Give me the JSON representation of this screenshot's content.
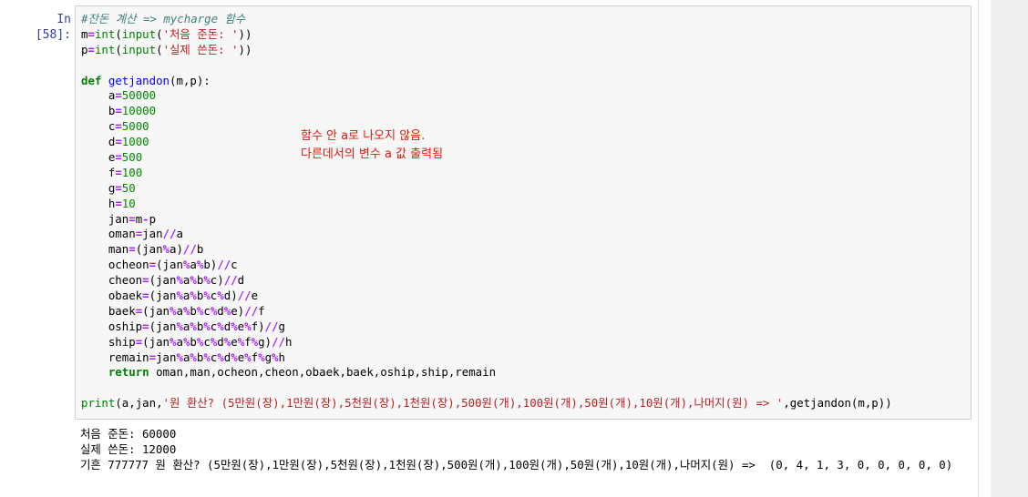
{
  "cell": {
    "prompt": "In [58]:",
    "code_lines": [
      [
        {
          "t": "cm",
          "v": "#잔돈 계산 => mycharge 함수"
        }
      ],
      [
        {
          "t": "",
          "v": "m"
        },
        {
          "t": "op",
          "v": "="
        },
        {
          "t": "bi",
          "v": "int"
        },
        {
          "t": "",
          "v": "("
        },
        {
          "t": "bi",
          "v": "input"
        },
        {
          "t": "",
          "v": "("
        },
        {
          "t": "str",
          "v": "'처음 준돈: '"
        },
        {
          "t": "",
          "v": "))"
        }
      ],
      [
        {
          "t": "",
          "v": "p"
        },
        {
          "t": "op",
          "v": "="
        },
        {
          "t": "bi",
          "v": "int"
        },
        {
          "t": "",
          "v": "("
        },
        {
          "t": "bi",
          "v": "input"
        },
        {
          "t": "",
          "v": "("
        },
        {
          "t": "str",
          "v": "'실제 쓴돈: '"
        },
        {
          "t": "",
          "v": "))"
        }
      ],
      [],
      [
        {
          "t": "kw",
          "v": "def"
        },
        {
          "t": "",
          "v": " "
        },
        {
          "t": "nf",
          "v": "getjandon"
        },
        {
          "t": "",
          "v": "(m,p):"
        }
      ],
      [
        {
          "t": "",
          "v": "    a"
        },
        {
          "t": "op",
          "v": "="
        },
        {
          "t": "num",
          "v": "50000"
        }
      ],
      [
        {
          "t": "",
          "v": "    b"
        },
        {
          "t": "op",
          "v": "="
        },
        {
          "t": "num",
          "v": "10000"
        }
      ],
      [
        {
          "t": "",
          "v": "    c"
        },
        {
          "t": "op",
          "v": "="
        },
        {
          "t": "num",
          "v": "5000"
        }
      ],
      [
        {
          "t": "",
          "v": "    d"
        },
        {
          "t": "op",
          "v": "="
        },
        {
          "t": "num",
          "v": "1000"
        }
      ],
      [
        {
          "t": "",
          "v": "    e"
        },
        {
          "t": "op",
          "v": "="
        },
        {
          "t": "num",
          "v": "500"
        }
      ],
      [
        {
          "t": "",
          "v": "    f"
        },
        {
          "t": "op",
          "v": "="
        },
        {
          "t": "num",
          "v": "100"
        }
      ],
      [
        {
          "t": "",
          "v": "    g"
        },
        {
          "t": "op",
          "v": "="
        },
        {
          "t": "num",
          "v": "50"
        }
      ],
      [
        {
          "t": "",
          "v": "    h"
        },
        {
          "t": "op",
          "v": "="
        },
        {
          "t": "num",
          "v": "10"
        }
      ],
      [
        {
          "t": "",
          "v": "    jan"
        },
        {
          "t": "op",
          "v": "="
        },
        {
          "t": "",
          "v": "m"
        },
        {
          "t": "op",
          "v": "-"
        },
        {
          "t": "",
          "v": "p"
        }
      ],
      [
        {
          "t": "",
          "v": "    oman"
        },
        {
          "t": "op",
          "v": "="
        },
        {
          "t": "",
          "v": "jan"
        },
        {
          "t": "op",
          "v": "//"
        },
        {
          "t": "",
          "v": "a"
        }
      ],
      [
        {
          "t": "",
          "v": "    man"
        },
        {
          "t": "op",
          "v": "="
        },
        {
          "t": "",
          "v": "(jan"
        },
        {
          "t": "op",
          "v": "%"
        },
        {
          "t": "",
          "v": "a)"
        },
        {
          "t": "op",
          "v": "//"
        },
        {
          "t": "",
          "v": "b"
        }
      ],
      [
        {
          "t": "",
          "v": "    ocheon"
        },
        {
          "t": "op",
          "v": "="
        },
        {
          "t": "",
          "v": "(jan"
        },
        {
          "t": "op",
          "v": "%"
        },
        {
          "t": "",
          "v": "a"
        },
        {
          "t": "op",
          "v": "%"
        },
        {
          "t": "",
          "v": "b)"
        },
        {
          "t": "op",
          "v": "//"
        },
        {
          "t": "",
          "v": "c"
        }
      ],
      [
        {
          "t": "",
          "v": "    cheon"
        },
        {
          "t": "op",
          "v": "="
        },
        {
          "t": "",
          "v": "(jan"
        },
        {
          "t": "op",
          "v": "%"
        },
        {
          "t": "",
          "v": "a"
        },
        {
          "t": "op",
          "v": "%"
        },
        {
          "t": "",
          "v": "b"
        },
        {
          "t": "op",
          "v": "%"
        },
        {
          "t": "",
          "v": "c)"
        },
        {
          "t": "op",
          "v": "//"
        },
        {
          "t": "",
          "v": "d"
        }
      ],
      [
        {
          "t": "",
          "v": "    obaek"
        },
        {
          "t": "op",
          "v": "="
        },
        {
          "t": "",
          "v": "(jan"
        },
        {
          "t": "op",
          "v": "%"
        },
        {
          "t": "",
          "v": "a"
        },
        {
          "t": "op",
          "v": "%"
        },
        {
          "t": "",
          "v": "b"
        },
        {
          "t": "op",
          "v": "%"
        },
        {
          "t": "",
          "v": "c"
        },
        {
          "t": "op",
          "v": "%"
        },
        {
          "t": "",
          "v": "d)"
        },
        {
          "t": "op",
          "v": "//"
        },
        {
          "t": "",
          "v": "e"
        }
      ],
      [
        {
          "t": "",
          "v": "    baek"
        },
        {
          "t": "op",
          "v": "="
        },
        {
          "t": "",
          "v": "(jan"
        },
        {
          "t": "op",
          "v": "%"
        },
        {
          "t": "",
          "v": "a"
        },
        {
          "t": "op",
          "v": "%"
        },
        {
          "t": "",
          "v": "b"
        },
        {
          "t": "op",
          "v": "%"
        },
        {
          "t": "",
          "v": "c"
        },
        {
          "t": "op",
          "v": "%"
        },
        {
          "t": "",
          "v": "d"
        },
        {
          "t": "op",
          "v": "%"
        },
        {
          "t": "",
          "v": "e)"
        },
        {
          "t": "op",
          "v": "//"
        },
        {
          "t": "",
          "v": "f"
        }
      ],
      [
        {
          "t": "",
          "v": "    oship"
        },
        {
          "t": "op",
          "v": "="
        },
        {
          "t": "",
          "v": "(jan"
        },
        {
          "t": "op",
          "v": "%"
        },
        {
          "t": "",
          "v": "a"
        },
        {
          "t": "op",
          "v": "%"
        },
        {
          "t": "",
          "v": "b"
        },
        {
          "t": "op",
          "v": "%"
        },
        {
          "t": "",
          "v": "c"
        },
        {
          "t": "op",
          "v": "%"
        },
        {
          "t": "",
          "v": "d"
        },
        {
          "t": "op",
          "v": "%"
        },
        {
          "t": "",
          "v": "e"
        },
        {
          "t": "op",
          "v": "%"
        },
        {
          "t": "",
          "v": "f)"
        },
        {
          "t": "op",
          "v": "//"
        },
        {
          "t": "",
          "v": "g"
        }
      ],
      [
        {
          "t": "",
          "v": "    ship"
        },
        {
          "t": "op",
          "v": "="
        },
        {
          "t": "",
          "v": "(jan"
        },
        {
          "t": "op",
          "v": "%"
        },
        {
          "t": "",
          "v": "a"
        },
        {
          "t": "op",
          "v": "%"
        },
        {
          "t": "",
          "v": "b"
        },
        {
          "t": "op",
          "v": "%"
        },
        {
          "t": "",
          "v": "c"
        },
        {
          "t": "op",
          "v": "%"
        },
        {
          "t": "",
          "v": "d"
        },
        {
          "t": "op",
          "v": "%"
        },
        {
          "t": "",
          "v": "e"
        },
        {
          "t": "op",
          "v": "%"
        },
        {
          "t": "",
          "v": "f"
        },
        {
          "t": "op",
          "v": "%"
        },
        {
          "t": "",
          "v": "g)"
        },
        {
          "t": "op",
          "v": "//"
        },
        {
          "t": "",
          "v": "h"
        }
      ],
      [
        {
          "t": "",
          "v": "    remain"
        },
        {
          "t": "op",
          "v": "="
        },
        {
          "t": "",
          "v": "jan"
        },
        {
          "t": "op",
          "v": "%"
        },
        {
          "t": "",
          "v": "a"
        },
        {
          "t": "op",
          "v": "%"
        },
        {
          "t": "",
          "v": "b"
        },
        {
          "t": "op",
          "v": "%"
        },
        {
          "t": "",
          "v": "c"
        },
        {
          "t": "op",
          "v": "%"
        },
        {
          "t": "",
          "v": "d"
        },
        {
          "t": "op",
          "v": "%"
        },
        {
          "t": "",
          "v": "e"
        },
        {
          "t": "op",
          "v": "%"
        },
        {
          "t": "",
          "v": "f"
        },
        {
          "t": "op",
          "v": "%"
        },
        {
          "t": "",
          "v": "g"
        },
        {
          "t": "op",
          "v": "%"
        },
        {
          "t": "",
          "v": "h"
        }
      ],
      [
        {
          "t": "",
          "v": "    "
        },
        {
          "t": "kw",
          "v": "return"
        },
        {
          "t": "",
          "v": " oman,man,ocheon,cheon,obaek,baek,oship,ship,remain"
        }
      ],
      [],
      [
        {
          "t": "bi",
          "v": "print"
        },
        {
          "t": "",
          "v": "(a,jan,"
        },
        {
          "t": "str",
          "v": "'원 환산? (5만원(장),1만원(장),5천원(장),1천원(장),500원(개),100원(개),50원(개),10원(개),나머지(원) => '"
        },
        {
          "t": "",
          "v": ",getjandon(m,p))"
        }
      ]
    ],
    "annotation": {
      "line1": "함수 안 a로 나오지 않음.",
      "line2": "다른데서의 변수 a 값 출력됨"
    },
    "output_lines": [
      "처음 준돈: 60000",
      "실제 쓴돈: 12000",
      "기흔 777777 원 환산? (5만원(장),1만원(장),5천원(장),1천원(장),500원(개),100원(개),50원(개),10원(개),나머지(원) =>  (0, 4, 1, 3, 0, 0, 0, 0, 0)"
    ]
  },
  "colors": {
    "annotation": "#e8150b",
    "prompt": "#303f9f",
    "keyword": "#008000",
    "operator": "#aa22ff",
    "string": "#ba2121",
    "function_name": "#0000ff",
    "comment": "#408080"
  }
}
